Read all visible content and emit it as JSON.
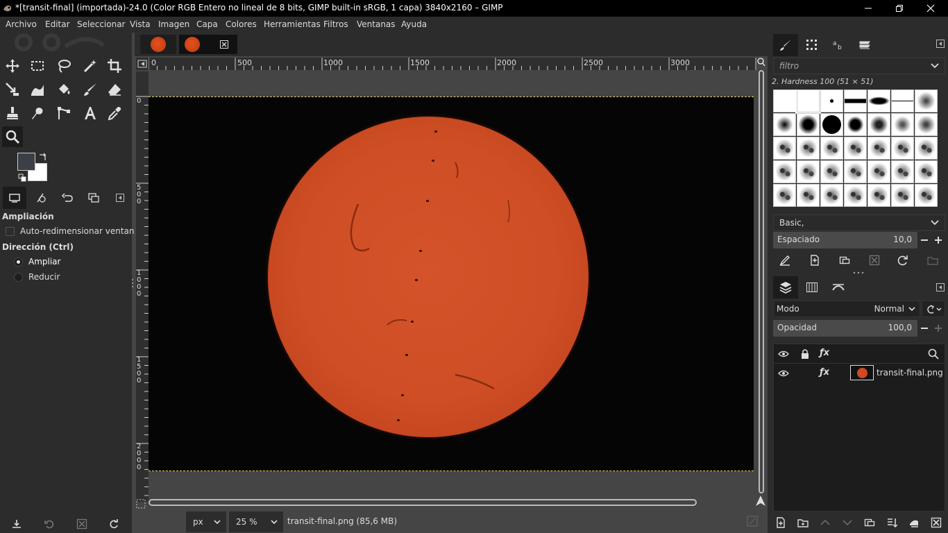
{
  "window": {
    "title": "*[transit-final] (importada)-24.0 (Color RGB Entero no lineal de 8 bits, GIMP built-in sRGB, 1 capa) 3840x2160 – GIMP"
  },
  "menu": [
    "Archivo",
    "Editar",
    "Seleccionar",
    "Vista",
    "Imagen",
    "Capa",
    "Colores",
    "Herramientas",
    "Filtros",
    "Ventanas",
    "Ayuda"
  ],
  "tool_options": {
    "title": "Ampliación",
    "auto_resize_label": "Auto-redimensionar ventana",
    "auto_resize_checked": false,
    "direction_title": "Dirección (Ctrl)",
    "direction_options": [
      "Ampliar",
      "Reducir"
    ],
    "direction_selected": "Ampliar"
  },
  "colors": {
    "foreground": "#3b3f47",
    "background": "#ffffff",
    "accent": "#dcdcdc"
  },
  "ruler": {
    "h_ticks": [
      "0",
      "500",
      "1000",
      "1500",
      "2000",
      "2500",
      "3000"
    ],
    "v_ticks": [
      "0",
      "500",
      "1000",
      "1500",
      "2000"
    ]
  },
  "statusbar": {
    "unit": "px",
    "zoom": "25 %",
    "file_info": "transit-final.png (85,6 MB)"
  },
  "brushes": {
    "filter_placeholder": "filtro",
    "selected_brush": "2. Hardness 100 (51 × 51)",
    "preset": "Basic,",
    "spacing_label": "Espaciado",
    "spacing_value": "10,0"
  },
  "layers": {
    "mode_label": "Modo",
    "mode_value": "Normal",
    "opacity_label": "Opacidad",
    "opacity_value": "100,0",
    "items": [
      {
        "name": "transit-final.png",
        "visible": true
      }
    ]
  }
}
